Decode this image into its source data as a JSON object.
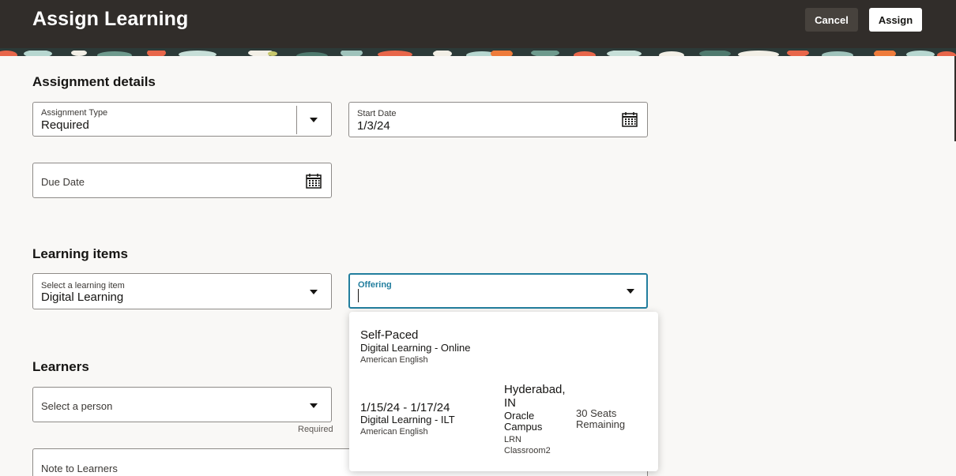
{
  "header": {
    "title": "Assign Learning",
    "cancel_label": "Cancel",
    "assign_label": "Assign"
  },
  "assignment_details": {
    "title": "Assignment details",
    "assignment_type": {
      "label": "Assignment Type",
      "value": "Required"
    },
    "start_date": {
      "label": "Start Date",
      "value": "1/3/24"
    },
    "due_date": {
      "placeholder": "Due Date"
    }
  },
  "learning_items": {
    "title": "Learning items",
    "learning_item": {
      "label": "Select a learning item",
      "value": "Digital Learning"
    },
    "offering": {
      "label": "Offering",
      "value": ""
    }
  },
  "learners": {
    "title": "Learners",
    "person": {
      "placeholder": "Select a person",
      "helper": "Required"
    },
    "note": {
      "placeholder": "Note to Learners"
    }
  },
  "offering_options": [
    {
      "title": "Self-Paced",
      "subtitle": "Digital Learning - Online",
      "language": "American English"
    },
    {
      "title": "1/15/24 - 1/17/24",
      "subtitle": "Digital Learning - ILT",
      "language": "American English",
      "location_line1": "Hyderabad,",
      "location_line2": "IN",
      "campus_line1": "Oracle",
      "campus_line2": "Campus",
      "room_line1": "LRN",
      "room_line2": "Classroom2",
      "seats_line1": "30 Seats",
      "seats_line2": "Remaining"
    }
  ],
  "colors": {
    "header_bg": "#312d2a",
    "accent": "#227e9e",
    "page_bg": "#f9f8f6"
  }
}
